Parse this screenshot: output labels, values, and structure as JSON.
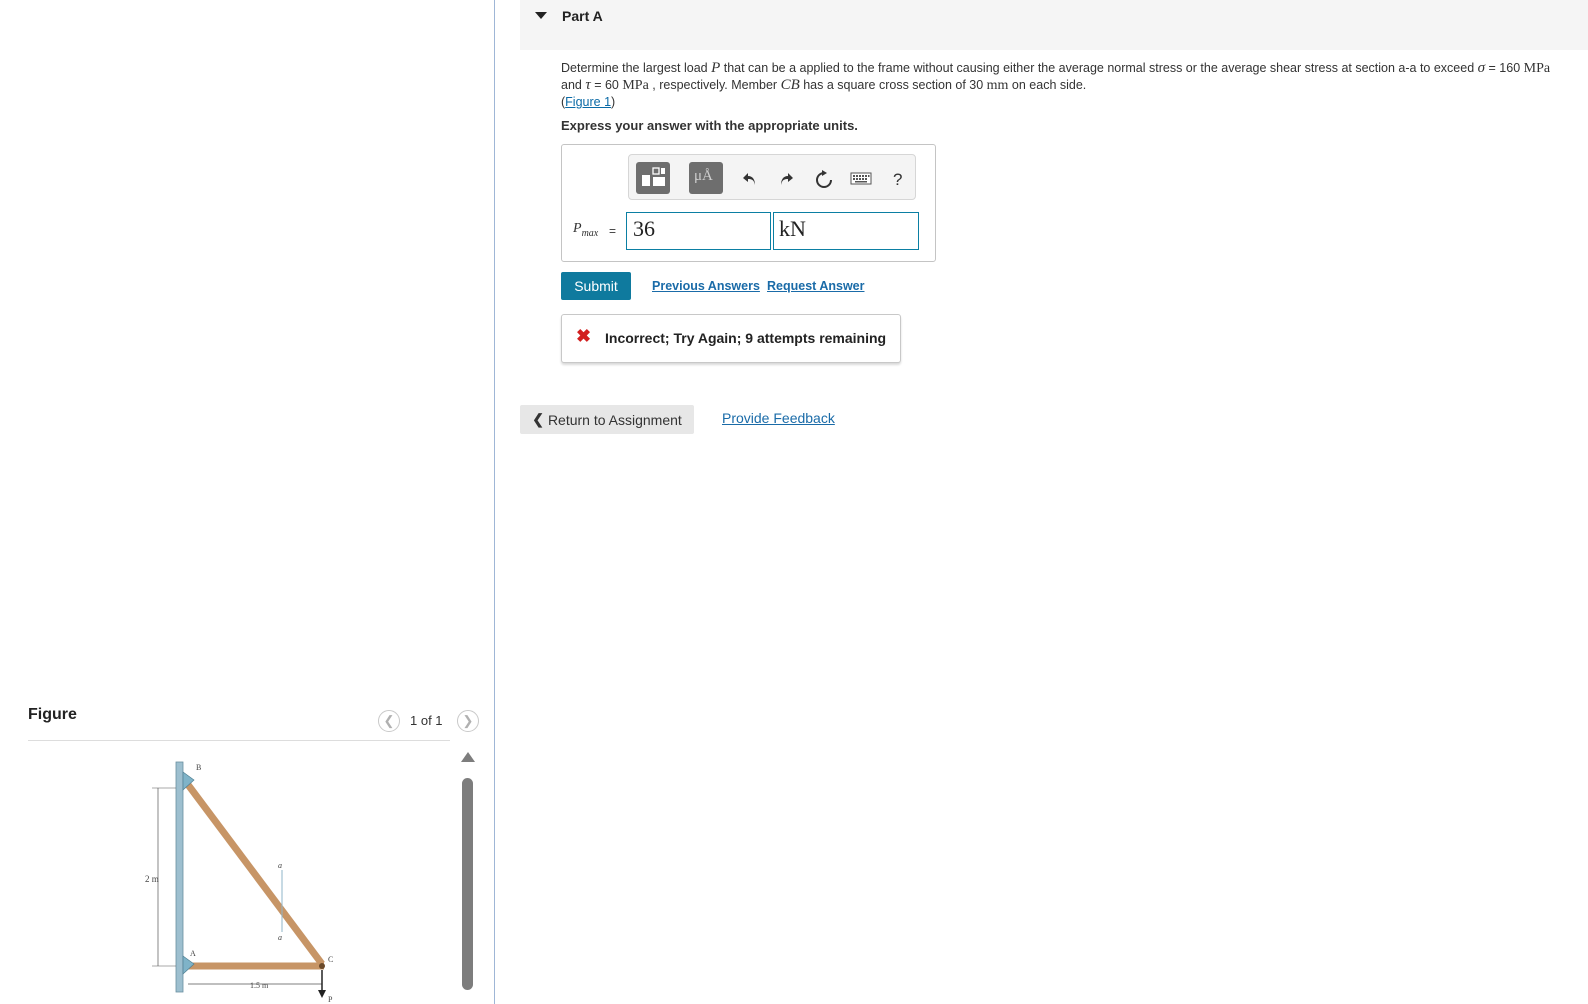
{
  "part": {
    "title": "Part A"
  },
  "question": {
    "text1": "Determine the largest load ",
    "var_p": "P",
    "text2": " that can be a applied to the frame without causing either the average normal stress or the average shear stress at section a-a to exceed ",
    "sigma": "σ",
    "text3": " = 160 ",
    "mpa1": "MPa",
    "text4": " and ",
    "tau": "τ",
    "text5": " = 60 ",
    "mpa2": "MPa",
    "text6": " , respectively. Member ",
    "cb": "CB",
    "text7": " has a square cross section of 30 ",
    "mm": "mm",
    "text8": " on each side.",
    "figure_link": "Figure 1"
  },
  "instruction": "Express your answer with the appropriate units.",
  "toolbar": {
    "templates_icon": "templates-icon",
    "units_label": "μÅ",
    "undo_icon": "undo-icon",
    "redo_icon": "redo-icon",
    "reset_icon": "reset-icon",
    "keyboard_icon": "keyboard-icon",
    "help_label": "?"
  },
  "answer": {
    "var": "P",
    "sub": "max",
    "equals": "=",
    "value": "36",
    "units": "kN"
  },
  "actions": {
    "submit": "Submit",
    "previous_answers": "Previous Answers",
    "request_answer": "Request Answer"
  },
  "feedback": {
    "icon": "✖",
    "message": "Incorrect; Try Again; 9 attempts remaining"
  },
  "footer": {
    "return": "Return to Assignment",
    "provide_feedback": "Provide Feedback"
  },
  "figure": {
    "title": "Figure",
    "counter": "1 of 1",
    "labels": {
      "b": "B",
      "a_upper": "a",
      "dim_vertical": "2 m",
      "a_lower": "a",
      "point_a": "A",
      "point_c": "C",
      "dim_horizontal": "1.5 m",
      "load_p": "P"
    }
  },
  "colors": {
    "accent": "#0f7a9e",
    "link": "#1a6ba8",
    "error": "#d21f1f",
    "member": "#c79566"
  }
}
